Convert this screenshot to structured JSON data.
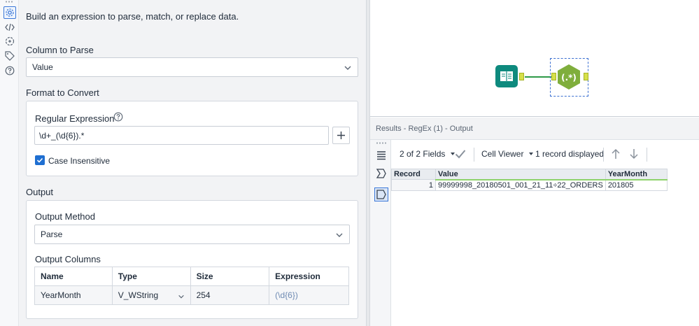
{
  "config": {
    "description": "Build an expression to parse, match, or replace data.",
    "column_to_parse": {
      "label": "Column to Parse",
      "value": "Value"
    },
    "format_to_convert": {
      "label": "Format to Convert",
      "regex_label": "Regular Expression",
      "regex_value": "\\d+_(\\d{6}).*",
      "case_insensitive_label": "Case Insensitive",
      "case_insensitive": true
    },
    "output": {
      "label": "Output",
      "method_label": "Output Method",
      "method_value": "Parse",
      "columns_label": "Output Columns",
      "columns_headers": [
        "Name",
        "Type",
        "Size",
        "Expression"
      ],
      "columns_rows": [
        {
          "name": "YearMonth",
          "type": "V_WString",
          "size": "254",
          "expression": "(\\d{6})"
        }
      ]
    }
  },
  "canvas": {
    "regex_node_label": "(.*)"
  },
  "results": {
    "title": "Results - RegEx (1) - Output",
    "fields_label": "2 of 2 Fields",
    "viewer_label": "Cell Viewer",
    "records_label": "1 record displayed",
    "headers": [
      "Record",
      "Value",
      "YearMonth"
    ],
    "rows": [
      {
        "record": "1",
        "value": "99999998_20180501_001_21_11÷22_ORDERS",
        "yearmonth": "201805"
      }
    ]
  },
  "colors": {
    "accent": "#1f6fd1",
    "input_node": "#0e8a7e",
    "regex_node": "#7fae3c",
    "connector": "#2e9a48",
    "anchor": "#d6e04a"
  },
  "icons": [
    "gear-icon",
    "code-icon",
    "regex-icon",
    "tag-icon",
    "help-icon",
    "chevron-down-icon",
    "plus-icon",
    "check-icon",
    "book-icon",
    "checkmark-icon",
    "arrow-up-icon",
    "arrow-down-icon"
  ]
}
